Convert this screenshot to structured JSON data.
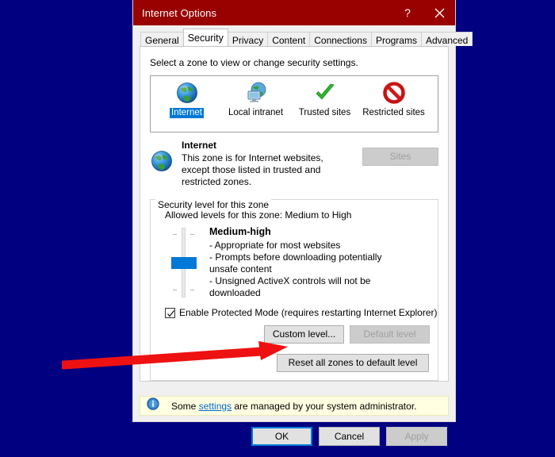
{
  "window": {
    "title": "Internet Options",
    "help_button": "?",
    "close_button": "×"
  },
  "tabs": [
    {
      "label": "General",
      "active": false
    },
    {
      "label": "Security",
      "active": true
    },
    {
      "label": "Privacy",
      "active": false
    },
    {
      "label": "Content",
      "active": false
    },
    {
      "label": "Connections",
      "active": false
    },
    {
      "label": "Programs",
      "active": false
    },
    {
      "label": "Advanced",
      "active": false
    }
  ],
  "security": {
    "instruction": "Select a zone to view or change security settings.",
    "zones": [
      {
        "label": "Internet",
        "icon": "globe-icon",
        "selected": true
      },
      {
        "label": "Local intranet",
        "icon": "intranet-icon",
        "selected": false
      },
      {
        "label": "Trusted sites",
        "icon": "green-check-icon",
        "selected": false
      },
      {
        "label": "Restricted sites",
        "icon": "red-prohibition-icon",
        "selected": false
      }
    ],
    "selected_zone": {
      "icon": "globe-icon",
      "title": "Internet",
      "description": "This zone is for Internet websites, except those listed in trusted and restricted zones."
    },
    "sites_button": {
      "label": "Sites",
      "disabled": true
    }
  },
  "level_group": {
    "legend": "Security level for this zone",
    "allowed_levels": "Allowed levels for this zone: Medium to High",
    "level_name": "Medium-high",
    "bullets": [
      "- Appropriate for most websites",
      "- Prompts before downloading potentially unsafe content",
      "- Unsigned ActiveX controls will not be downloaded"
    ],
    "protected_mode": {
      "label": "Enable Protected Mode (requires restarting Internet Explorer)",
      "checked": true
    },
    "custom_level_button": {
      "label": "Custom level...",
      "disabled": false
    },
    "default_level_button": {
      "label": "Default level",
      "disabled": true
    },
    "reset_button": {
      "label": "Reset all zones to default level",
      "disabled": false
    }
  },
  "info_bar": {
    "icon": "info-icon",
    "text_before": "Some ",
    "link": "settings",
    "text_after": " are managed by your system administrator."
  },
  "footer": {
    "ok": {
      "label": "OK",
      "default": true
    },
    "cancel": {
      "label": "Cancel"
    },
    "apply": {
      "label": "Apply",
      "disabled": true
    }
  },
  "annotation": {
    "type": "red-arrow",
    "color": "#ee1111",
    "points_to": "Reset all zones to default level"
  },
  "colors": {
    "desktop_background": "#000080",
    "titlebar": "#990000",
    "accent_selection": "#0078d7",
    "info_bar_background": "#ffffe1"
  }
}
